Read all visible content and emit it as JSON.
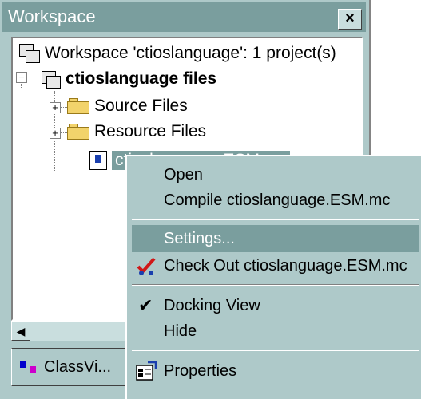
{
  "panel": {
    "title": "Workspace",
    "close_glyph": "×"
  },
  "tree": {
    "workspace_label": "Workspace 'ctioslanguage': 1 project(s)",
    "project_label": "ctioslanguage files",
    "source_files": "Source Files",
    "resource_files": "Resource Files",
    "selected_item": "ctioslanguage.ESM.mc",
    "expand_glyph": "+",
    "collapse_glyph": "−"
  },
  "tabs": {
    "classview": "ClassVi..."
  },
  "context_menu": {
    "open": "Open",
    "compile": "Compile ctioslanguage.ESM.mc",
    "settings": "Settings...",
    "checkout": "Check Out ctioslanguage.ESM.mc",
    "docking": "Docking View",
    "hide": "Hide",
    "properties": "Properties",
    "check_glyph": "✔"
  },
  "colors": {
    "panel_bg": "#aec9c9",
    "highlight": "#7a9e9e"
  }
}
